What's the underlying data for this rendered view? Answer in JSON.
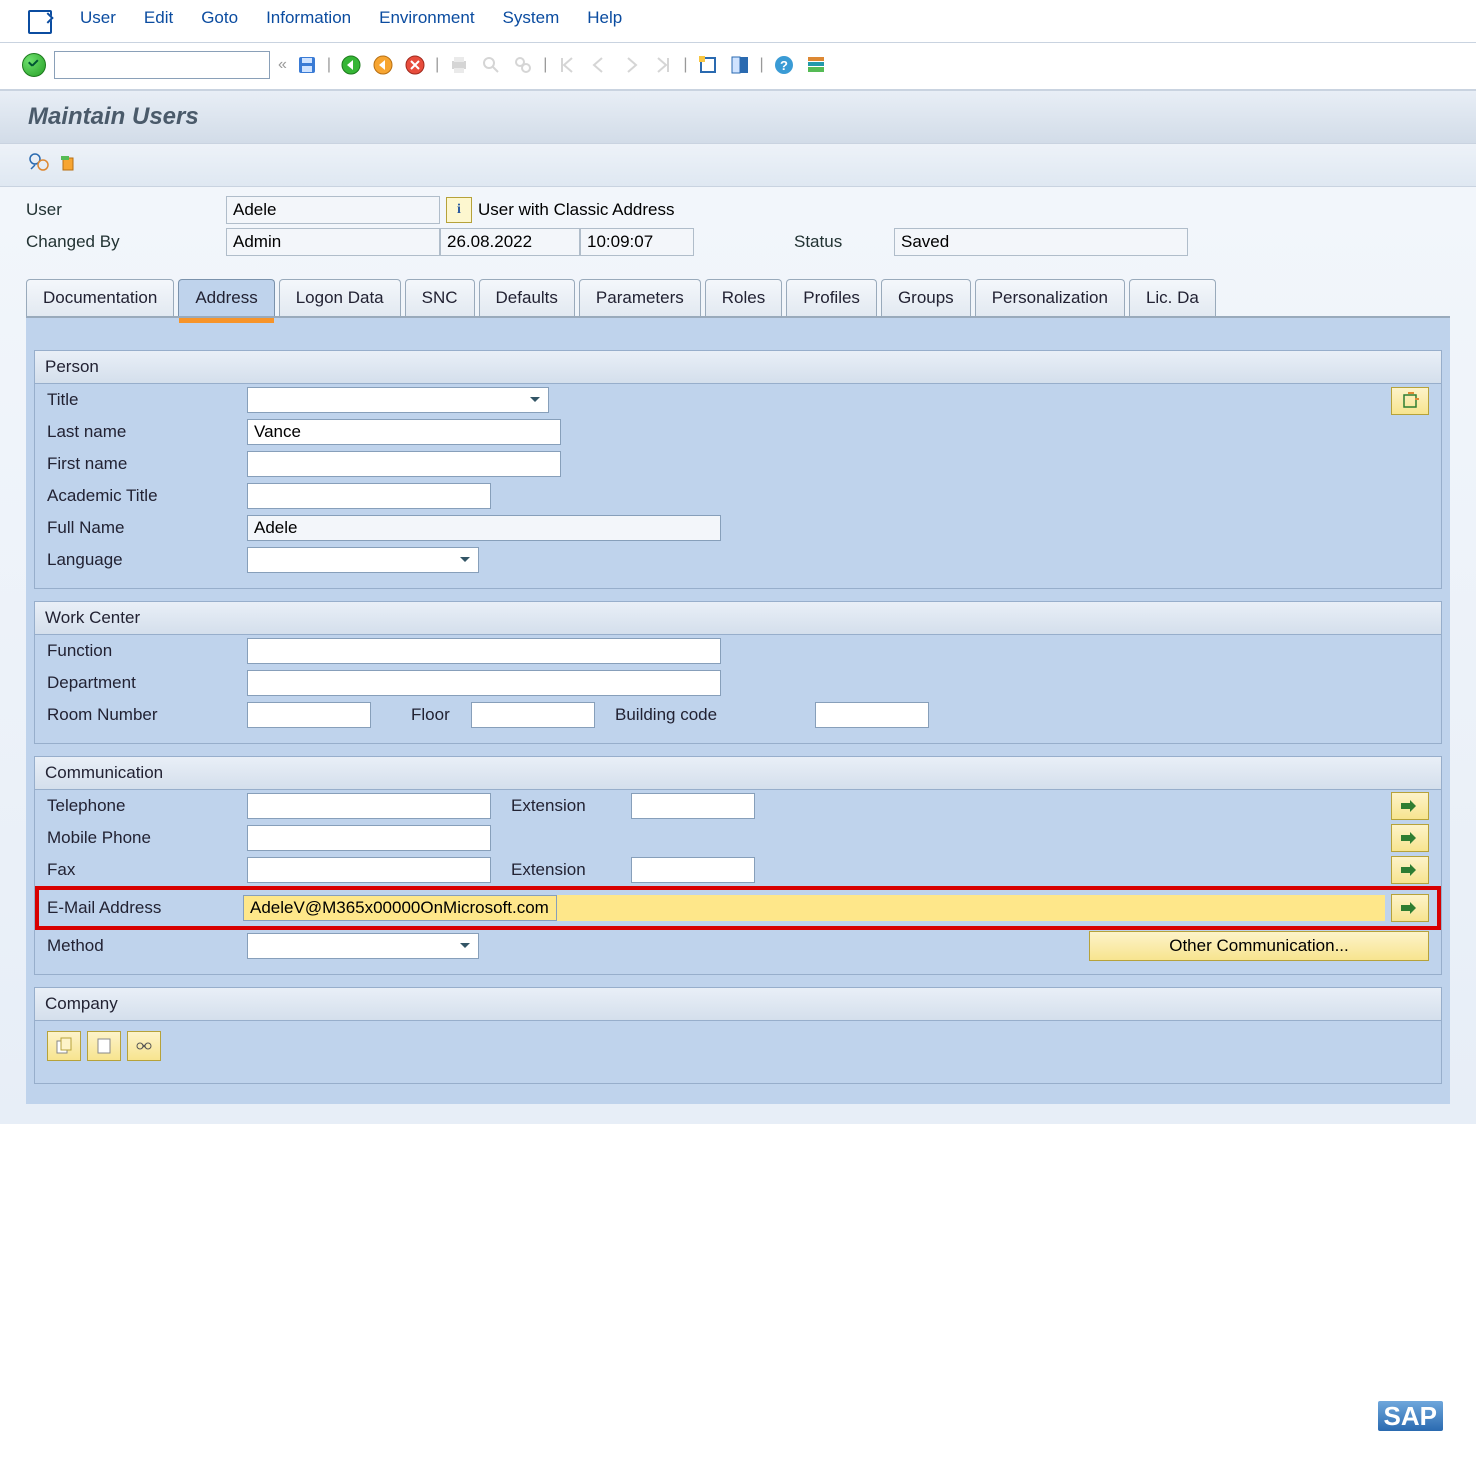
{
  "menus": [
    "User",
    "Edit",
    "Goto",
    "Information",
    "Environment",
    "System",
    "Help"
  ],
  "page_title": "Maintain Users",
  "header": {
    "user_label": "User",
    "user_value": "Adele",
    "classic_addr": "User with Classic Address",
    "changed_by_label": "Changed By",
    "changed_by_value": "Admin",
    "changed_date": "26.08.2022",
    "changed_time": "10:09:07",
    "status_label": "Status",
    "status_value": "Saved"
  },
  "tabs": [
    "Documentation",
    "Address",
    "Logon Data",
    "SNC",
    "Defaults",
    "Parameters",
    "Roles",
    "Profiles",
    "Groups",
    "Personalization",
    "Lic. Da"
  ],
  "active_tab": "Address",
  "person": {
    "legend": "Person",
    "title_label": "Title",
    "title_value": "",
    "last_name_label": "Last name",
    "last_name_value": "Vance",
    "first_name_label": "First name",
    "first_name_value": "",
    "acad_label": "Academic Title",
    "acad_value": "",
    "full_name_label": "Full Name",
    "full_name_value": "Adele",
    "language_label": "Language",
    "language_value": ""
  },
  "workcenter": {
    "legend": "Work Center",
    "function_label": "Function",
    "function_value": "",
    "department_label": "Department",
    "department_value": "",
    "room_label": "Room Number",
    "room_value": "",
    "floor_label": "Floor",
    "floor_value": "",
    "building_label": "Building code",
    "building_value": ""
  },
  "comm": {
    "legend": "Communication",
    "tel_label": "Telephone",
    "tel_value": "",
    "ext_label": "Extension",
    "tel_ext_value": "",
    "mobile_label": "Mobile Phone",
    "mobile_value": "",
    "fax_label": "Fax",
    "fax_value": "",
    "fax_ext_value": "",
    "email_label": "E-Mail Address",
    "email_value": "AdeleV@M365x00000OnMicrosoft.com",
    "method_label": "Method",
    "method_value": "",
    "other_btn": "Other Communication..."
  },
  "company": {
    "legend": "Company"
  }
}
